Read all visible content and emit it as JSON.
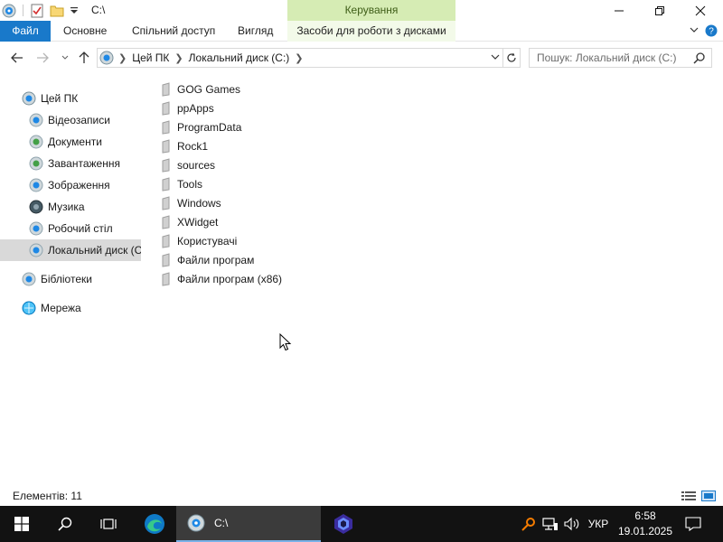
{
  "window": {
    "title": "C:\\",
    "context_tab_header": "Керування"
  },
  "ribbon": {
    "tabs": [
      "Файл",
      "Основне",
      "Спільний доступ",
      "Вигляд",
      "Засоби для роботи з дисками"
    ]
  },
  "address": {
    "crumbs": [
      "Цей ПК",
      "Локальний диск (C:)"
    ],
    "search_placeholder": "Пошук: Локальний диск (C:)"
  },
  "nav_pane": {
    "items": [
      {
        "label": "Цей ПК",
        "icon": "computer-icon"
      },
      {
        "label": "Відеозаписи",
        "icon": "videos-icon"
      },
      {
        "label": "Документи",
        "icon": "documents-icon"
      },
      {
        "label": "Завантаження",
        "icon": "downloads-icon"
      },
      {
        "label": "Зображення",
        "icon": "pictures-icon"
      },
      {
        "label": "Музика",
        "icon": "music-icon"
      },
      {
        "label": "Робочий стіл",
        "icon": "desktop-icon"
      },
      {
        "label": "Локальний диск (C:)",
        "icon": "drive-icon"
      },
      {
        "label": "Бібліотеки",
        "icon": "libraries-icon"
      },
      {
        "label": "Мережа",
        "icon": "network-icon"
      }
    ],
    "selected": "Локальний диск (C:)"
  },
  "files": [
    "GOG Games",
    "ppApps",
    "ProgramData",
    "Rock1",
    "sources",
    "Tools",
    "Windows",
    "XWidget",
    "Користувачі",
    "Файли програм",
    "Файли програм (x86)"
  ],
  "status": {
    "item_count": "Елементів: 11"
  },
  "taskbar": {
    "active_window_label": "C:\\",
    "language": "УКР",
    "time": "6:58",
    "date": "19.01.2025"
  },
  "colors": {
    "file_tab": "#1979ca",
    "context_tab": "#d6ecb4",
    "selected_nav": "#d9d9d9",
    "taskbar": "#121212"
  }
}
